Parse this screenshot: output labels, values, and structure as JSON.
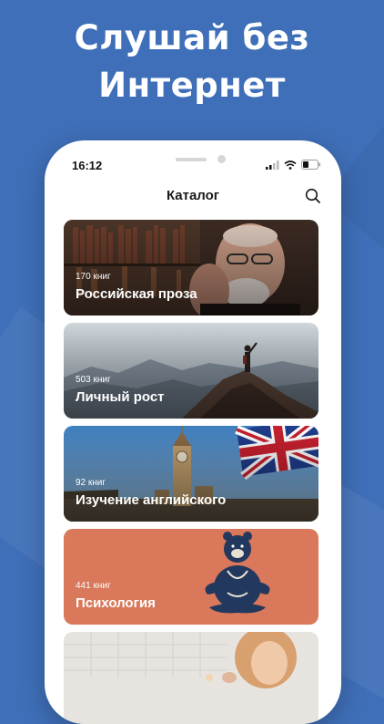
{
  "promo": {
    "line1": "Слушай без",
    "line2": "Интернет"
  },
  "status_bar": {
    "time": "16:12"
  },
  "header": {
    "title": "Каталог",
    "search_icon": "search-icon"
  },
  "categories": [
    {
      "count": "170 книг",
      "title": "Российская проза"
    },
    {
      "count": "503 книг",
      "title": "Личный рост"
    },
    {
      "count": "92 книг",
      "title": "Изучение английского"
    },
    {
      "count": "441 книг",
      "title": "Психология"
    }
  ],
  "colors": {
    "background": "#3f6fb8",
    "psychology_card": "#d9785a"
  }
}
